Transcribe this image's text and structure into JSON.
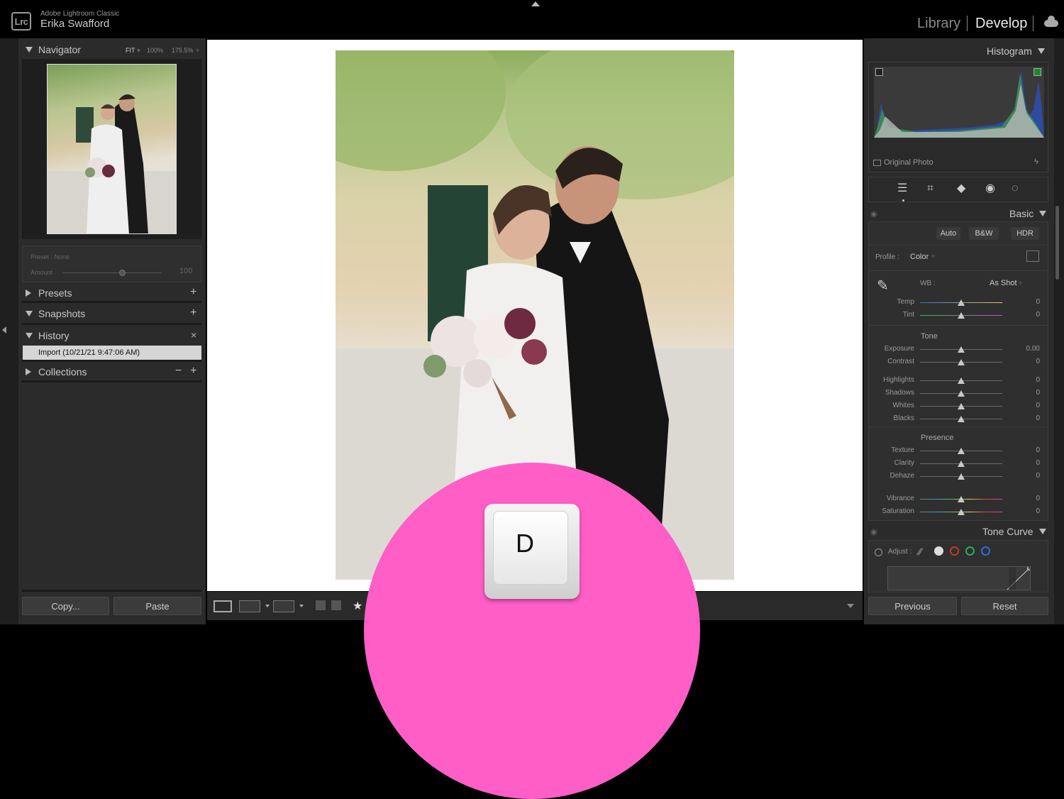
{
  "app": {
    "logo": "Lrc",
    "name": "Adobe Lightroom Classic",
    "user": "Erika Swafford"
  },
  "modules": {
    "library": "Library",
    "develop": "Develop",
    "separator": "|"
  },
  "left": {
    "navigator": {
      "title": "Navigator",
      "fit": "FIT ÷",
      "z100": "100%",
      "z175": "175.5%",
      "zarrow": "÷"
    },
    "preset": {
      "label": "Preset : None",
      "amount_label": "Amount",
      "amount_value": "100",
      "amount_fraction": 0.6
    },
    "presets": {
      "title": "Presets",
      "plus": "+"
    },
    "snapshots": {
      "title": "Snapshots",
      "plus": "+"
    },
    "history": {
      "title": "History",
      "close": "×",
      "item": "Import (10/21/21 9:47:06 AM)"
    },
    "collections": {
      "title": "Collections",
      "minus": "−",
      "plus": "+"
    },
    "copy": "Copy...",
    "paste": "Paste"
  },
  "key_overlay": {
    "letter": "D",
    "color": "#ff5ec7"
  },
  "toolbar": {
    "rating_star": "★"
  },
  "right": {
    "histogram": {
      "title": "Histogram",
      "original_photo": "Original Photo"
    },
    "basic": {
      "title": "Basic",
      "auto": "Auto",
      "bw": "B&W",
      "hdr": "HDR",
      "profile_label": "Profile :",
      "profile_value": "Color",
      "profile_arrow": "÷",
      "wb_label": "WB :",
      "wb_value": "As Shot",
      "wb_arrow": "÷",
      "temp": {
        "label": "Temp",
        "value": "0"
      },
      "tint": {
        "label": "Tint",
        "value": "0"
      },
      "tone_title": "Tone",
      "exposure": {
        "label": "Exposure",
        "value": "0.00"
      },
      "contrast": {
        "label": "Contrast",
        "value": "0"
      },
      "highlights": {
        "label": "Highlights",
        "value": "0"
      },
      "shadows": {
        "label": "Shadows",
        "value": "0"
      },
      "whites": {
        "label": "Whites",
        "value": "0"
      },
      "blacks": {
        "label": "Blacks",
        "value": "0"
      },
      "presence_title": "Presence",
      "texture": {
        "label": "Texture",
        "value": "0"
      },
      "clarity": {
        "label": "Clarity",
        "value": "0"
      },
      "dehaze": {
        "label": "Dehaze",
        "value": "0"
      },
      "vibrance": {
        "label": "Vibrance",
        "value": "0"
      },
      "saturation": {
        "label": "Saturation",
        "value": "0"
      }
    },
    "tonecurve": {
      "title": "Tone Curve",
      "adjust_label": "Adjust :"
    },
    "previous": "Previous",
    "reset": "Reset"
  }
}
